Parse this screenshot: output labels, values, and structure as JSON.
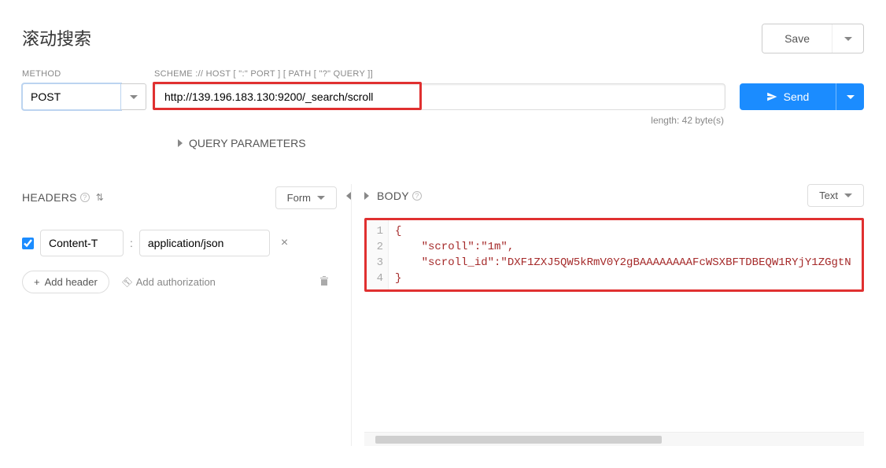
{
  "page_title": "滚动搜索",
  "save": {
    "label": "Save"
  },
  "method": {
    "label": "METHOD",
    "value": "POST"
  },
  "url": {
    "label": "SCHEME :// HOST [ \":\" PORT ] [ PATH [ \"?\" QUERY ]]",
    "value": "http://139.196.183.130:9200/_search/scroll"
  },
  "send": {
    "label": "Send"
  },
  "length_info": "length: 42 byte(s)",
  "query_params": {
    "label": "QUERY PARAMETERS"
  },
  "headers": {
    "title": "HEADERS",
    "form_label": "Form",
    "items": [
      {
        "enabled": true,
        "name": "Content-T",
        "value": "application/json"
      }
    ],
    "add_label": "Add header",
    "auth_label": "Add authorization"
  },
  "body": {
    "title": "BODY",
    "mode_label": "Text",
    "lines": [
      "{",
      "    \"scroll\":\"1m\",",
      "    \"scroll_id\":\"DXF1ZXJ5QW5kRmV0Y2gBAAAAAAAAFcWSXBFTDBEQW1RYjY1ZGgtN",
      "}"
    ]
  }
}
